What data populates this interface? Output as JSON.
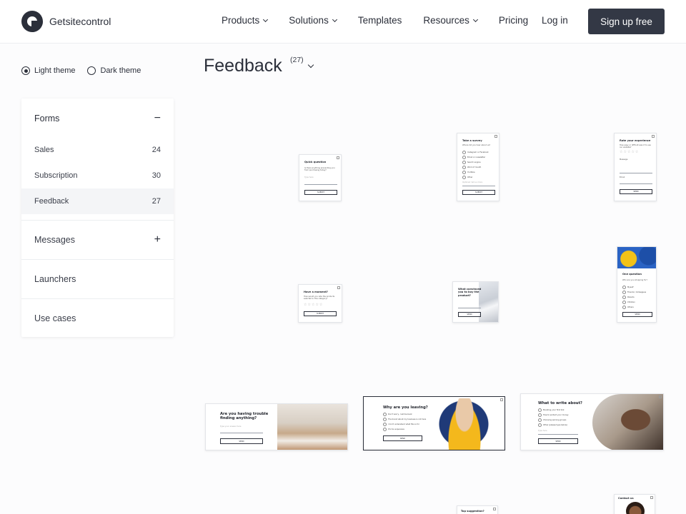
{
  "header": {
    "brand": "Getsitecontrol",
    "nav": [
      {
        "label": "Products",
        "has_menu": true
      },
      {
        "label": "Solutions",
        "has_menu": true
      },
      {
        "label": "Templates",
        "has_menu": false
      },
      {
        "label": "Resources",
        "has_menu": true
      },
      {
        "label": "Pricing",
        "has_menu": false
      }
    ],
    "login": "Log in",
    "signup": "Sign up free"
  },
  "themes": {
    "light": "Light theme",
    "dark": "Dark theme",
    "selected": "light"
  },
  "sidebar": {
    "forms": {
      "label": "Forms",
      "toggle": "−",
      "items": [
        {
          "label": "Sales",
          "count": "24"
        },
        {
          "label": "Subscription",
          "count": "30"
        },
        {
          "label": "Feedback",
          "count": "27",
          "active": true
        }
      ]
    },
    "messages": {
      "label": "Messages",
      "toggle": "+"
    },
    "launchers": {
      "label": "Launchers"
    },
    "use_cases": {
      "label": "Use cases"
    }
  },
  "main": {
    "title": "Feedback",
    "count": "(27)"
  },
  "cards": {
    "c1": {
      "title": "Quick question",
      "text": "Is there anything preventing you from purchasing today?",
      "field": "Type here",
      "button": "SUBMIT"
    },
    "c2": {
      "title": "Take a survey",
      "text": "Where did you hear about us?",
      "options": [
        "Instagram or Facebook",
        "Email or newsletter",
        "Search engine",
        "Word of mouth",
        "YouTube",
        "Other"
      ],
      "field": "Optional: tell us more",
      "button": "SUBMIT"
    },
    "c3": {
      "title": "Rate your experience",
      "text": "How easy or difficult was it to use our website?",
      "stars": "☆☆☆☆☆",
      "label1": "Message",
      "label2": "Email",
      "button": "SEND"
    },
    "c4": {
      "title": "Have a moment?",
      "text": "How would you rate the products selected in this category?",
      "stars": "☆☆☆☆☆",
      "button": "SUBMIT"
    },
    "c5": {
      "title": "What convinced you to buy the product?",
      "button": "SEND"
    },
    "c6": {
      "title": "One question",
      "text": "Who are you shopping for?",
      "options": [
        "Myself",
        "Friends / Colleagues",
        "Parents",
        "Children",
        "Others"
      ],
      "button": "SEND"
    },
    "c7": {
      "title": "Are you having trouble finding anything?",
      "field": "Type your answer here",
      "button": "SEND"
    },
    "c8": {
      "title": "Why are you leaving?",
      "options": [
        "Don't worry, I will be back",
        "The brand about my business is not here",
        "I don't understand what this is for",
        "It's too expensive"
      ],
      "button": "SEND"
    },
    "c9": {
      "title": "What to write about?",
      "options": [
        "Boosting your first $1k",
        "How to protect your money",
        "Choosing earning groups",
        "Other (please type below)"
      ],
      "field": "Type here",
      "button": "SEND"
    },
    "c10": {
      "title": "Top suggestion?"
    },
    "c11": {
      "title": "Contact us"
    }
  }
}
